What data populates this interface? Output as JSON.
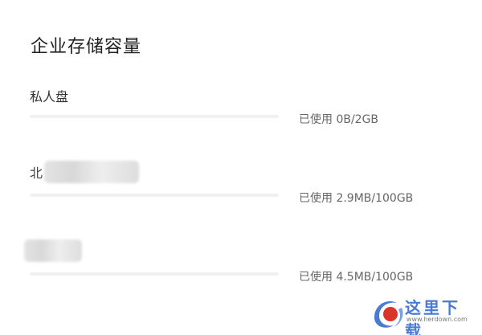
{
  "title": "企业存储容量",
  "items": [
    {
      "label": "私人盘",
      "label_obscured": false,
      "usage": "已使用 0B/2GB",
      "used_fraction": 0.0
    },
    {
      "label": "北",
      "label_obscured": true,
      "usage": "已使用 2.9MB/100GB",
      "used_fraction": 3e-05
    },
    {
      "label": "",
      "label_obscured": true,
      "usage": "已使用 4.5MB/100GB",
      "used_fraction": 4e-05
    }
  ],
  "watermark": {
    "text": "这里下载",
    "url": "www.herdown.com",
    "logo": "swirl-logo-icon"
  },
  "colors": {
    "bar_track": "#f1f1f1",
    "bar_fill": "#4a8cf7",
    "watermark_blue": "#4a7ad1",
    "watermark_red": "#d9352b"
  }
}
